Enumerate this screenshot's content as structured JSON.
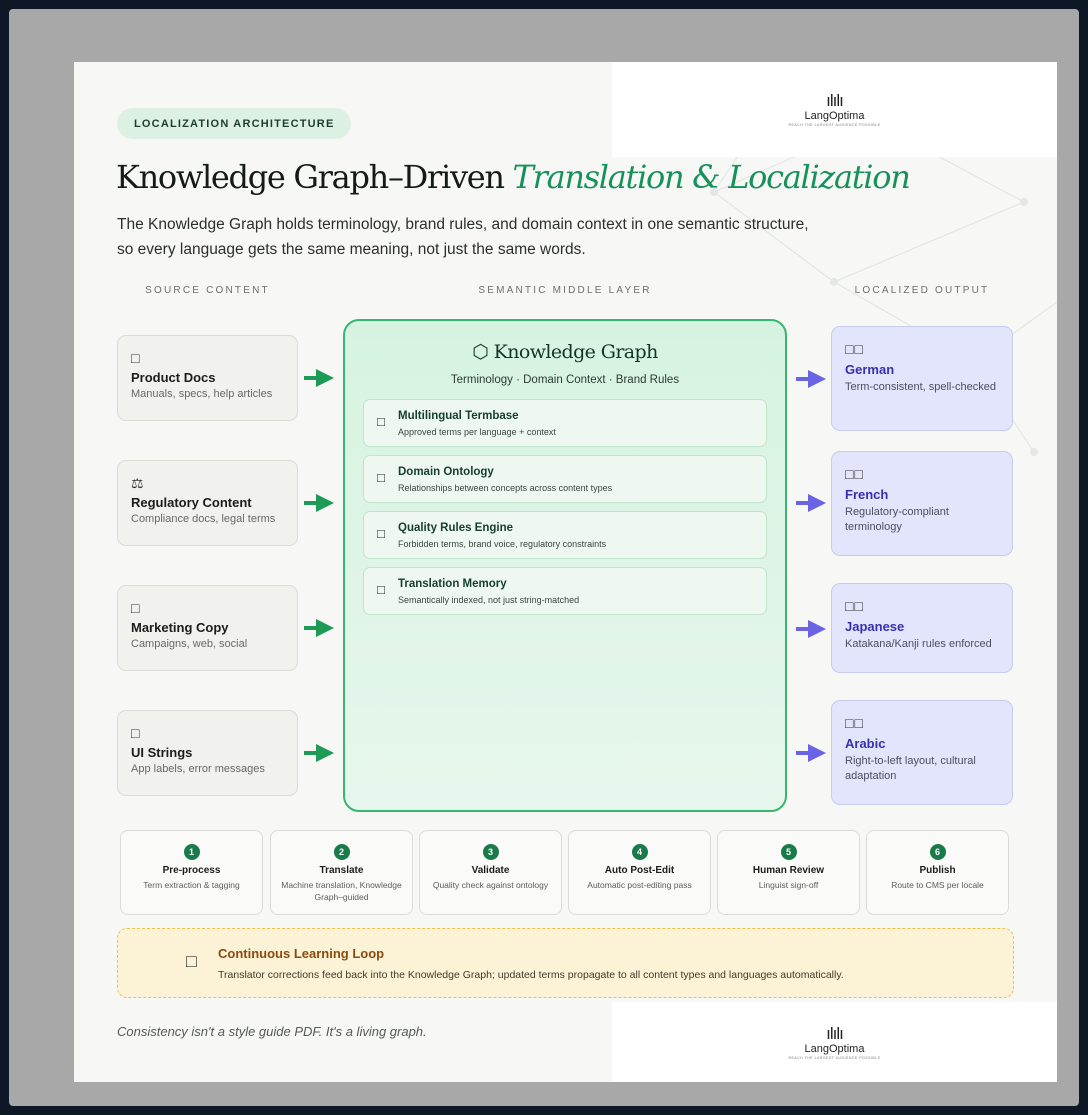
{
  "badge": "LOCALIZATION ARCHITECTURE",
  "brand": {
    "mark": "ılılı",
    "name": "LangOptima",
    "tagline": "REACH THE LARGEST AUDIENCE POSSIBLE"
  },
  "title": {
    "plain": "Knowledge Graph–Driven",
    "accent": "Translation & Localization"
  },
  "subtitle": "The Knowledge Graph holds terminology, brand rules, and domain context in one semantic structure, so every language gets the same meaning, not just the same words.",
  "columns": {
    "source": "SOURCE CONTENT",
    "middle": "SEMANTIC MIDDLE LAYER",
    "output": "LOCALIZED OUTPUT"
  },
  "sources": [
    {
      "icon": "□",
      "name": "Product Docs",
      "desc": "Manuals, specs, help articles"
    },
    {
      "icon": "⚖",
      "name": "Regulatory Content",
      "desc": "Compliance docs, legal terms"
    },
    {
      "icon": "□",
      "name": "Marketing Copy",
      "desc": "Campaigns, web, social"
    },
    {
      "icon": "□",
      "name": "UI Strings",
      "desc": "App labels, error messages"
    }
  ],
  "kg": {
    "title": "⬡ Knowledge Graph",
    "subtitle": "Terminology · Domain Context · Brand Rules",
    "items": [
      {
        "icon": "□",
        "name": "Multilingual Termbase",
        "desc": "Approved terms per language + context"
      },
      {
        "icon": "□",
        "name": "Domain Ontology",
        "desc": "Relationships between concepts across content types"
      },
      {
        "icon": "□",
        "name": "Quality Rules Engine",
        "desc": "Forbidden terms, brand voice, regulatory constraints"
      },
      {
        "icon": "□",
        "name": "Translation Memory",
        "desc": "Semantically indexed, not just string-matched"
      }
    ]
  },
  "outputs": [
    {
      "icon": "□□",
      "name": "German",
      "desc": "Term-consistent, spell-checked"
    },
    {
      "icon": "□□",
      "name": "French",
      "desc": "Regulatory-compliant terminology"
    },
    {
      "icon": "□□",
      "name": "Japanese",
      "desc": "Katakana/Kanji rules enforced"
    },
    {
      "icon": "□□",
      "name": "Arabic",
      "desc": "Right-to-left layout, cultural adaptation"
    }
  ],
  "steps": [
    {
      "num": "1",
      "name": "Pre-process",
      "desc": "Term extraction & tagging"
    },
    {
      "num": "2",
      "name": "Translate",
      "desc": "Machine translation, Knowledge Graph–guided"
    },
    {
      "num": "3",
      "name": "Validate",
      "desc": "Quality check against ontology"
    },
    {
      "num": "4",
      "name": "Auto Post-Edit",
      "desc": "Automatic post-editing pass"
    },
    {
      "num": "5",
      "name": "Human Review",
      "desc": "Linguist sign-off"
    },
    {
      "num": "6",
      "name": "Publish",
      "desc": "Route to CMS per locale"
    }
  ],
  "loop": {
    "icon": "□",
    "name": "Continuous Learning Loop",
    "desc": "Translator corrections feed back into the Knowledge Graph; updated terms propagate to all content types and languages automatically."
  },
  "footer": "Consistency isn't a style guide PDF. It's a living graph.",
  "colors": {
    "accent_green": "#17915a",
    "arrow_green": "#1e9a57",
    "arrow_purple": "#6b63e6",
    "output_name": "#3a2fb0"
  }
}
